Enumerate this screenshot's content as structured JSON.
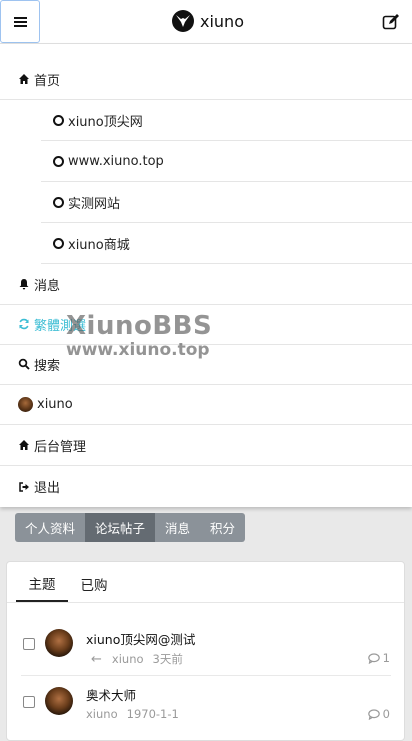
{
  "header": {
    "brand": "xiuno",
    "menu_icon": "hamburger-icon",
    "edit_icon": "edit-icon"
  },
  "nav": {
    "home": "首页",
    "forums": [
      "xiuno顶尖网",
      "www.xiuno.top",
      "实测网站",
      "xiuno商城"
    ],
    "messages": "消息",
    "refresh": "繁體測選",
    "search": "搜索",
    "user": "xiuno",
    "admin": "后台管理",
    "logout": "退出"
  },
  "watermark": {
    "title": "XiunoBBS",
    "url": "www.xiuno.top"
  },
  "profile_tabs": [
    "个人资料",
    "论坛帖子",
    "消息",
    "积分"
  ],
  "profile_tab_active": 1,
  "content_tabs": [
    "主题",
    "已购"
  ],
  "content_tab_active": 0,
  "threads": [
    {
      "subject": "xiuno顶尖网@测试",
      "arrow": "←",
      "user": "xiuno",
      "time": "3天前",
      "replies": "1"
    },
    {
      "subject": "奥术大师",
      "arrow": "",
      "user": "xiuno",
      "time": "1970-1-1",
      "replies": "0"
    }
  ],
  "colors": {
    "accent": "#3bbdd4",
    "tab": "#8b9299",
    "tab_active": "#646b72"
  }
}
